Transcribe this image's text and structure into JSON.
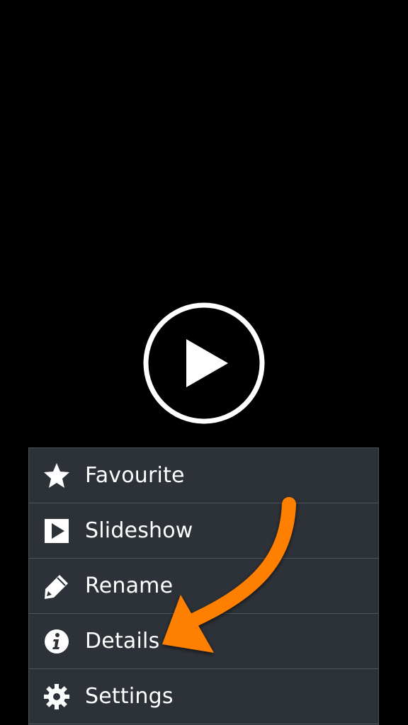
{
  "menu": {
    "items": [
      {
        "label": "Favourite",
        "icon": "star-icon"
      },
      {
        "label": "Slideshow",
        "icon": "slideshow-icon"
      },
      {
        "label": "Rename",
        "icon": "pencil-icon"
      },
      {
        "label": "Details",
        "icon": "info-icon"
      },
      {
        "label": "Settings",
        "icon": "gear-icon"
      }
    ]
  },
  "colors": {
    "background": "#000000",
    "menu_background": "#2d3238",
    "menu_divider": "#4f555c",
    "text": "#ffffff",
    "annotation_arrow": "#ff7f00"
  }
}
